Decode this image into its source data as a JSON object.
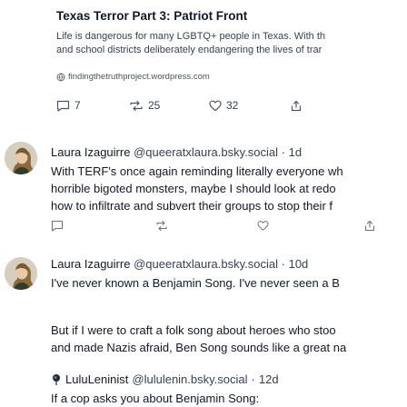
{
  "link_card": {
    "title": "Texas Terror Part 3: Patriot Front",
    "description_lines": [
      "Life is dangerous for many LGBTQ+ people in Texas. With th",
      "and school districts deliberately endangering the lives of trar"
    ],
    "domain": "findingthetruthproject.wordpress.com"
  },
  "top_stats": {
    "replies": "7",
    "reposts": "25",
    "likes": "32"
  },
  "posts": [
    {
      "author": "Laura Izaguirre",
      "handle": "@queeratxlaura.bsky.social",
      "time": "1d",
      "lines": [
        "With TERF's once again reminding literally everyone wh",
        "horrible bigoted monsters, maybe I should look at redo",
        "how to infiltrate and subvert their groups to stop their f"
      ]
    },
    {
      "author": "Laura Izaguirre",
      "handle": "@queeratxlaura.bsky.social",
      "time": "10d",
      "lines": [
        "I've never known a Benjamin Song. I've never seen a B"
      ],
      "lines2": [
        "But if I were to craft a folk song about heroes who stoo",
        "and made Nazis afraid, Ben Song sounds like a great na"
      ]
    },
    {
      "author": "LuluLeninist",
      "handle": "@lululenin.bsky.social",
      "time": "12d",
      "lines": [
        "If a cop asks you about Benjamin Song:"
      ]
    }
  ],
  "separator": "·",
  "icons": [
    "globe-icon",
    "reply-icon",
    "repost-icon",
    "like-icon",
    "share-icon",
    "rose-icon",
    "avatar-icon"
  ],
  "colors": {
    "text": "#111827",
    "muted": "#374151",
    "icon": "#6b7280"
  }
}
